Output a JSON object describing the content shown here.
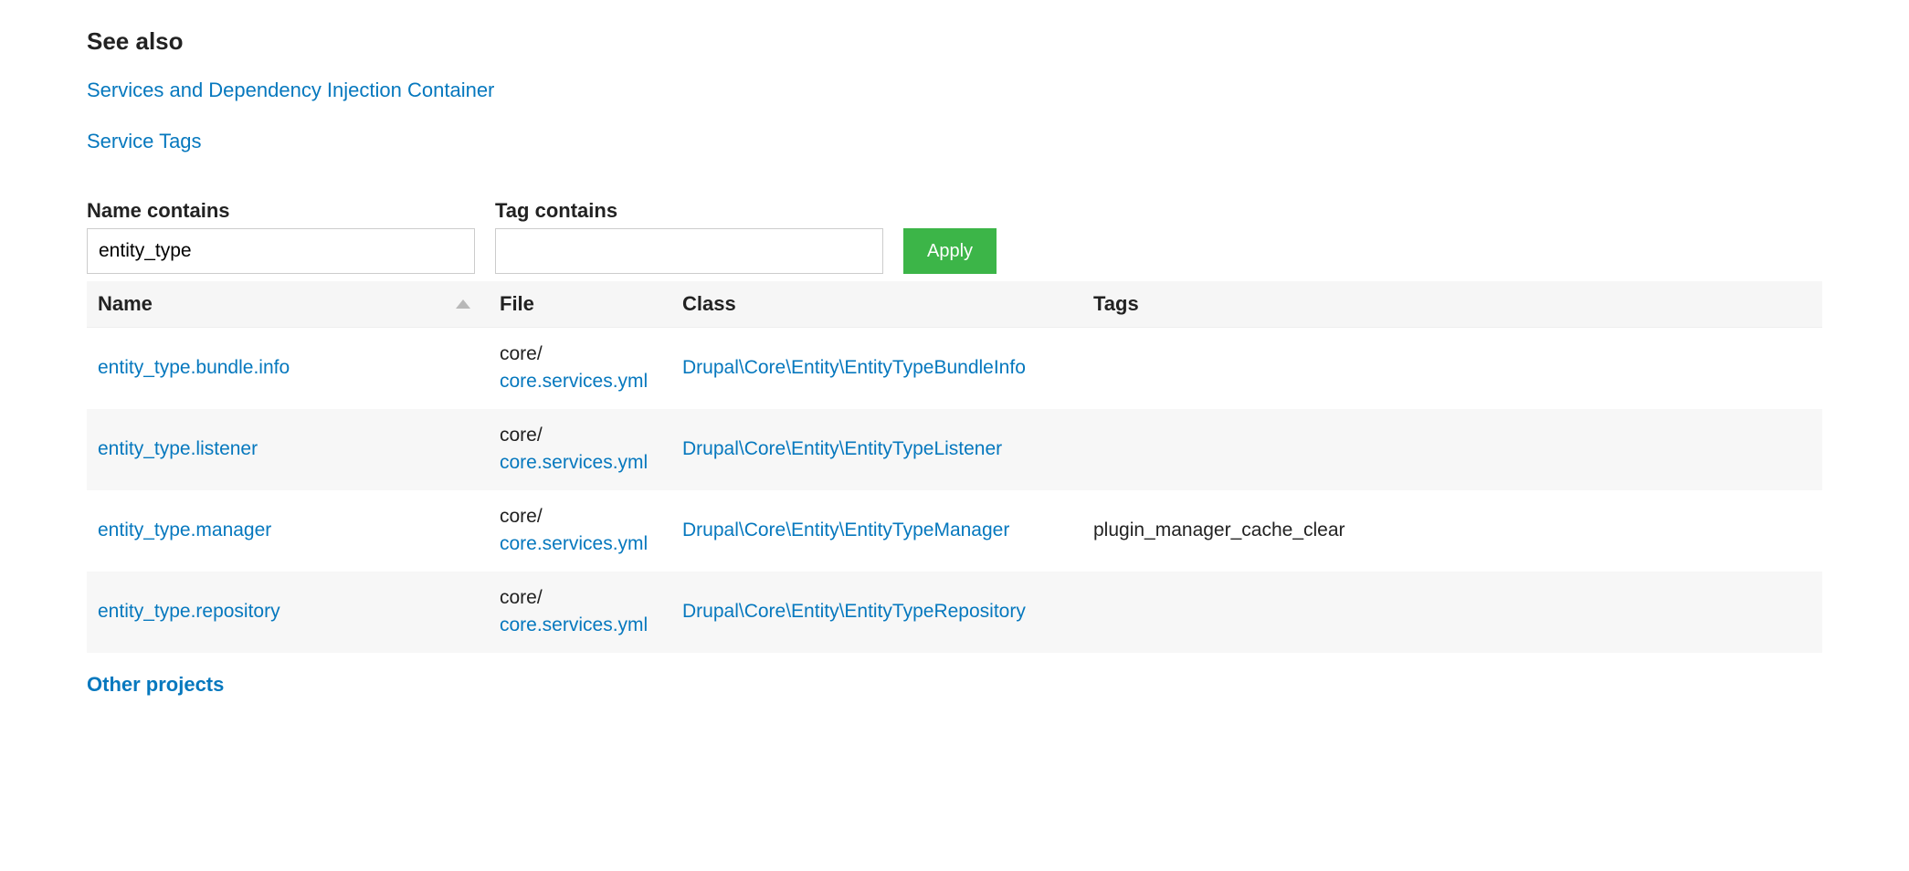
{
  "see_also": {
    "heading": "See also",
    "links": [
      "Services and Dependency Injection Container",
      "Service Tags"
    ]
  },
  "filters": {
    "name_label": "Name contains",
    "name_value": "entity_type",
    "tag_label": "Tag contains",
    "tag_value": "",
    "apply_label": "Apply"
  },
  "table": {
    "headers": {
      "name": "Name",
      "file": "File",
      "class": "Class",
      "tags": "Tags"
    },
    "rows": [
      {
        "name": "entity_type.bundle.info",
        "file_dir": "core/",
        "file_link": "core.services.yml",
        "class": "Drupal\\Core\\Entity\\EntityTypeBundleInfo",
        "tags": ""
      },
      {
        "name": "entity_type.listener",
        "file_dir": "core/",
        "file_link": "core.services.yml",
        "class": "Drupal\\Core\\Entity\\EntityTypeListener",
        "tags": ""
      },
      {
        "name": "entity_type.manager",
        "file_dir": "core/",
        "file_link": "core.services.yml",
        "class": "Drupal\\Core\\Entity\\EntityTypeManager",
        "tags": "plugin_manager_cache_clear"
      },
      {
        "name": "entity_type.repository",
        "file_dir": "core/",
        "file_link": "core.services.yml",
        "class": "Drupal\\Core\\Entity\\EntityTypeRepository",
        "tags": ""
      }
    ]
  },
  "footer": {
    "other_projects": "Other projects"
  }
}
